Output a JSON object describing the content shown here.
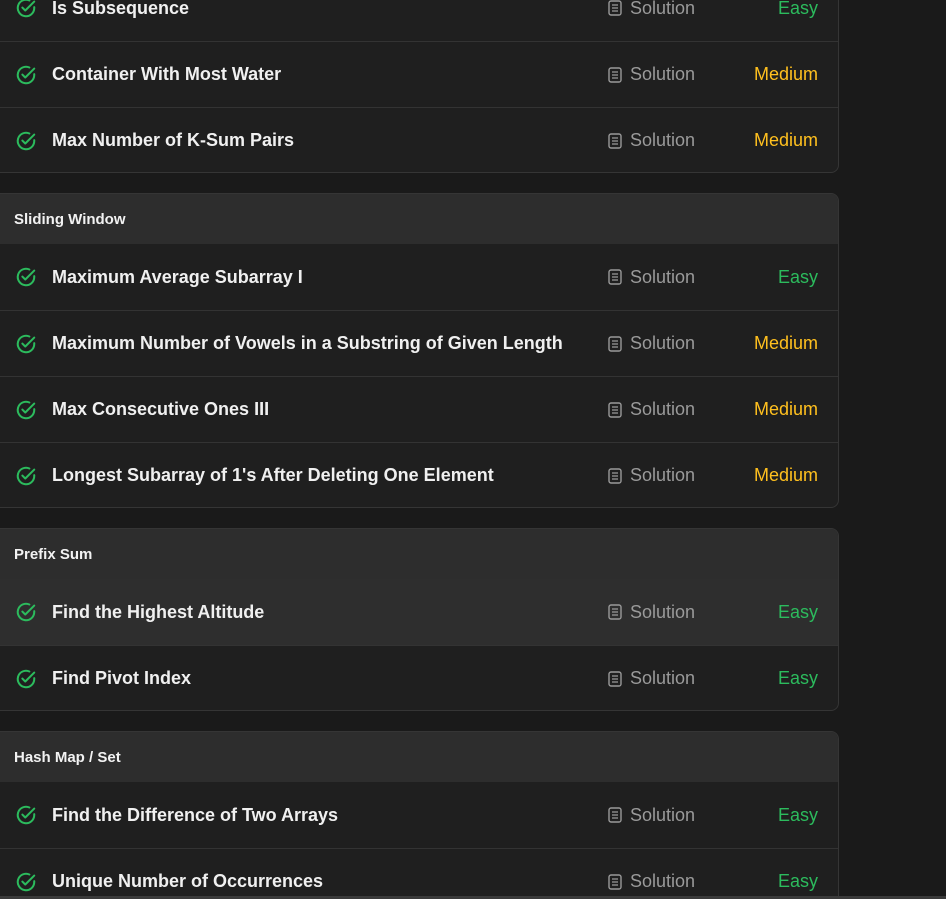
{
  "colors": {
    "easy": "#2cbb5d",
    "medium": "#ffc01e",
    "check": "#2cbb5d",
    "solution_text": "#9a9a9a"
  },
  "solution_label": "Solution",
  "sections": [
    {
      "header": "",
      "problems": [
        {
          "title": "Is Subsequence",
          "difficulty": "Easy",
          "solved": true
        },
        {
          "title": "Container With Most Water",
          "difficulty": "Medium",
          "solved": true
        },
        {
          "title": "Max Number of K-Sum Pairs",
          "difficulty": "Medium",
          "solved": true
        }
      ]
    },
    {
      "header": "Sliding Window",
      "problems": [
        {
          "title": "Maximum Average Subarray I",
          "difficulty": "Easy",
          "solved": true
        },
        {
          "title": "Maximum Number of Vowels in a Substring of Given Length",
          "difficulty": "Medium",
          "solved": true
        },
        {
          "title": "Max Consecutive Ones III",
          "difficulty": "Medium",
          "solved": true
        },
        {
          "title": "Longest Subarray of 1's After Deleting One Element",
          "difficulty": "Medium",
          "solved": true
        }
      ]
    },
    {
      "header": "Prefix Sum",
      "problems": [
        {
          "title": "Find the Highest Altitude",
          "difficulty": "Easy",
          "solved": true,
          "hovered": true
        },
        {
          "title": "Find Pivot Index",
          "difficulty": "Easy",
          "solved": true
        }
      ]
    },
    {
      "header": "Hash Map / Set",
      "problems": [
        {
          "title": "Find the Difference of Two Arrays",
          "difficulty": "Easy",
          "solved": true
        },
        {
          "title": "Unique Number of Occurrences",
          "difficulty": "Easy",
          "solved": true
        }
      ]
    }
  ]
}
